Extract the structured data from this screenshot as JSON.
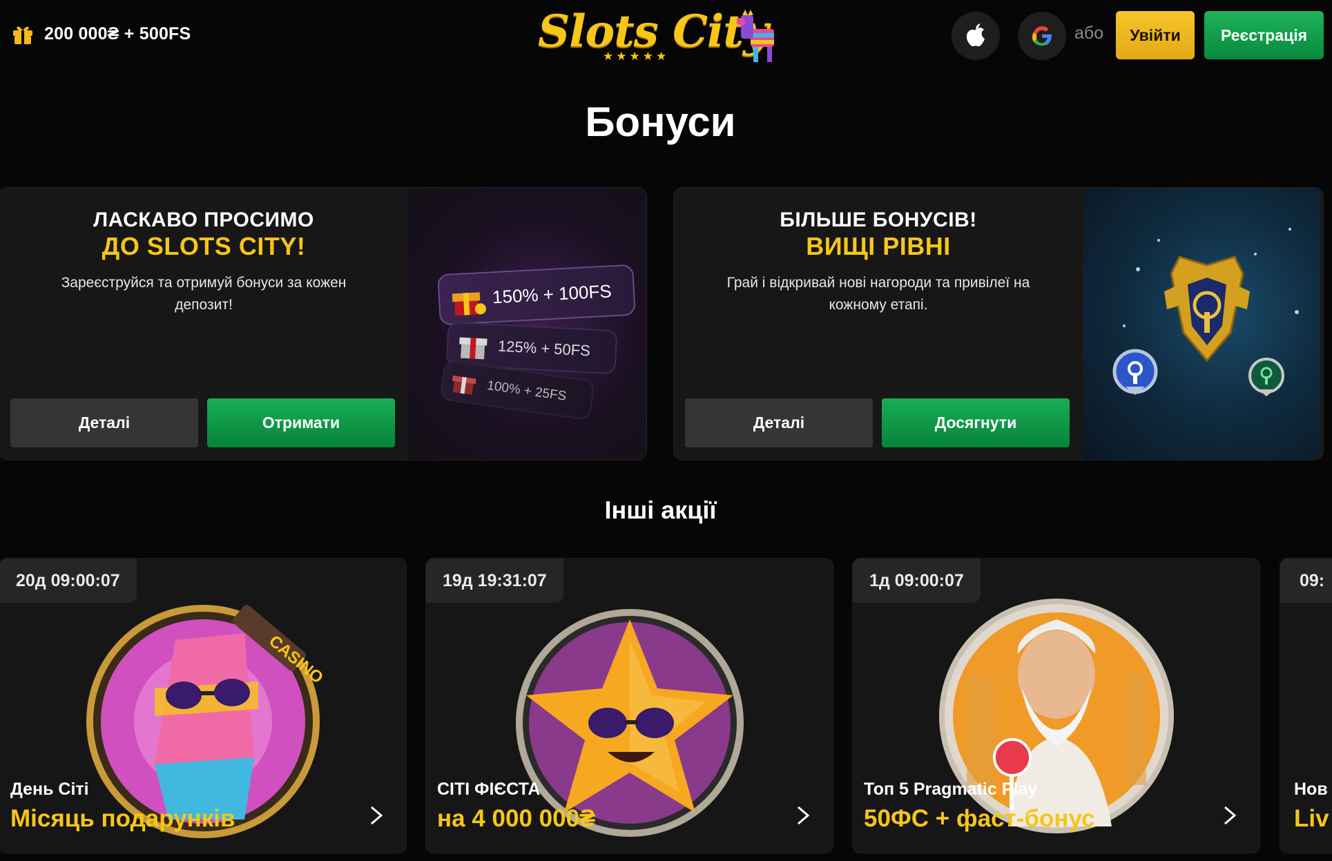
{
  "header": {
    "promo_text": "200 000₴ + 500FS",
    "logo_text": "Slots City",
    "logo_stars": "★★★★★",
    "or_text": "або",
    "login_label": "Увійти",
    "register_label": "Реєстрація"
  },
  "page_title": "Бонуси",
  "bonus_cards": [
    {
      "title_line1": "ЛАСКАВО ПРОСИМО",
      "title_line2": "ДО SLOTS CITY!",
      "description": "Зареєструйся та отримуй бонуси за кожен депозит!",
      "details_label": "Деталі",
      "action_label": "Отримати",
      "tiers": [
        "150% + 100FS",
        "125% + 50FS",
        "100% + 25FS"
      ]
    },
    {
      "title_line1": "БІЛЬШЕ БОНУСІВ!",
      "title_line2": "ВИЩІ РІВНІ",
      "description": "Грай і відкривай нові нагороди та привілеї на кожному етапі.",
      "details_label": "Деталі",
      "action_label": "Досягнути"
    }
  ],
  "section_title": "Інші акції",
  "promos": [
    {
      "timer": "20д 09:00:07",
      "subtitle": "День Сіті",
      "title": "Місяць подарунків"
    },
    {
      "timer": "19д 19:31:07",
      "subtitle": "СІТІ ФІЄСТА",
      "title": "на 4 000 000₴"
    },
    {
      "timer": "1д 09:00:07",
      "subtitle": "Топ 5 Pragmatic Play",
      "title": "50ФС + фаст-бонус"
    },
    {
      "timer": "09:",
      "subtitle": "Нов",
      "title": "Liv"
    }
  ],
  "colors": {
    "accent_yellow": "#f6c618",
    "green": "#0a9a45",
    "background": "#060606"
  }
}
